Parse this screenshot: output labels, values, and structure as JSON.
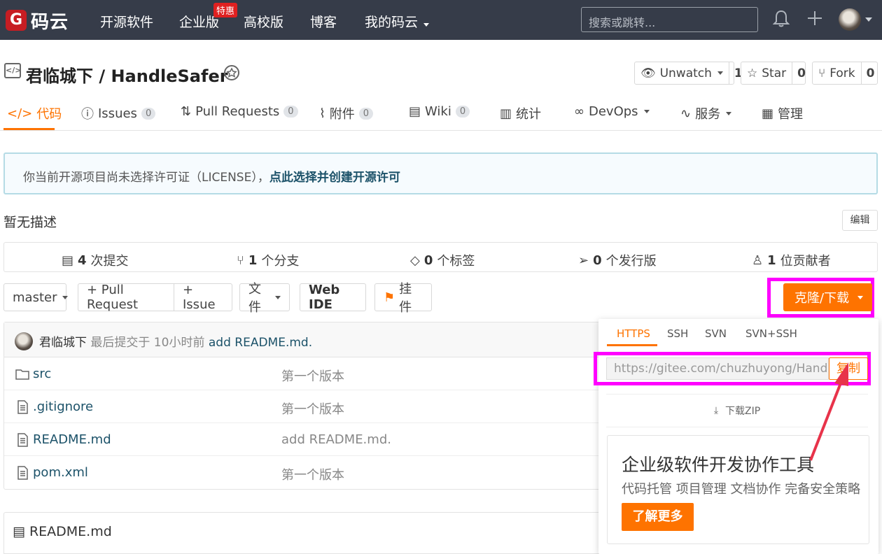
{
  "nav": {
    "logo_mark": "G",
    "logo_text": "码云",
    "links": [
      "开源软件",
      "企业版",
      "高校版",
      "博客",
      "我的码云"
    ],
    "hot_badge": "特惠",
    "search_placeholder": "搜索或跳转..."
  },
  "repo": {
    "icon": "</>",
    "title": "君临城下 / HandleSafer",
    "unwatch_label": "Unwatch",
    "unwatch_count": "1",
    "star_label": "Star",
    "star_count": "0",
    "fork_label": "Fork",
    "fork_count": "0"
  },
  "tabs": [
    {
      "label": "代码"
    },
    {
      "label": "Issues",
      "badge": "0"
    },
    {
      "label": "Pull Requests",
      "badge": "0"
    },
    {
      "label": "附件",
      "badge": "0"
    },
    {
      "label": "Wiki",
      "badge": "0"
    },
    {
      "label": "统计"
    },
    {
      "label": "DevOps"
    },
    {
      "label": "服务"
    },
    {
      "label": "管理"
    }
  ],
  "notice": {
    "text": "你当前开源项目尚未选择许可证（LICENSE），",
    "link": "点此选择并创建开源许可"
  },
  "description": "暂无描述",
  "edit_label": "编辑",
  "stats": [
    {
      "num": "4",
      "label": "次提交"
    },
    {
      "num": "1",
      "label": "个分支"
    },
    {
      "num": "0",
      "label": "个标签"
    },
    {
      "num": "0",
      "label": "个发行版"
    },
    {
      "num": "1",
      "label": "位贡献者"
    }
  ],
  "toolbar": {
    "branch": "master",
    "pull_request": "+ Pull Request",
    "issue": "+ Issue",
    "files": "文件",
    "web_ide": "Web IDE",
    "widget": "挂件",
    "clone": "克隆/下载"
  },
  "commit": {
    "author": "君临城下",
    "meta": "最后提交于 10小时前",
    "message": "add README.md."
  },
  "files": [
    {
      "name": "src",
      "msg": "第一个版本",
      "type": "folder"
    },
    {
      "name": ".gitignore",
      "msg": "第一个版本",
      "type": "file"
    },
    {
      "name": "README.md",
      "msg": "add README.md.",
      "type": "file"
    },
    {
      "name": "pom.xml",
      "msg": "第一个版本",
      "type": "file"
    }
  ],
  "readme_title": "README.md",
  "clone_dropdown": {
    "tabs": [
      "HTTPS",
      "SSH",
      "SVN",
      "SVN+SSH"
    ],
    "url": "https://gitee.com/chuzhuyong/HandleSafer.git",
    "copy": "复制",
    "download_zip": "下载ZIP",
    "promo_title": "企业级软件开发协作工具",
    "promo_sub": "代码托管 项目管理 文档协作 完备安全策略",
    "promo_btn": "了解更多"
  },
  "colors": {
    "accent": "#fe7300",
    "nav_bg": "#363c49",
    "highlight": "#ff00ff",
    "link": "#1c5269"
  }
}
